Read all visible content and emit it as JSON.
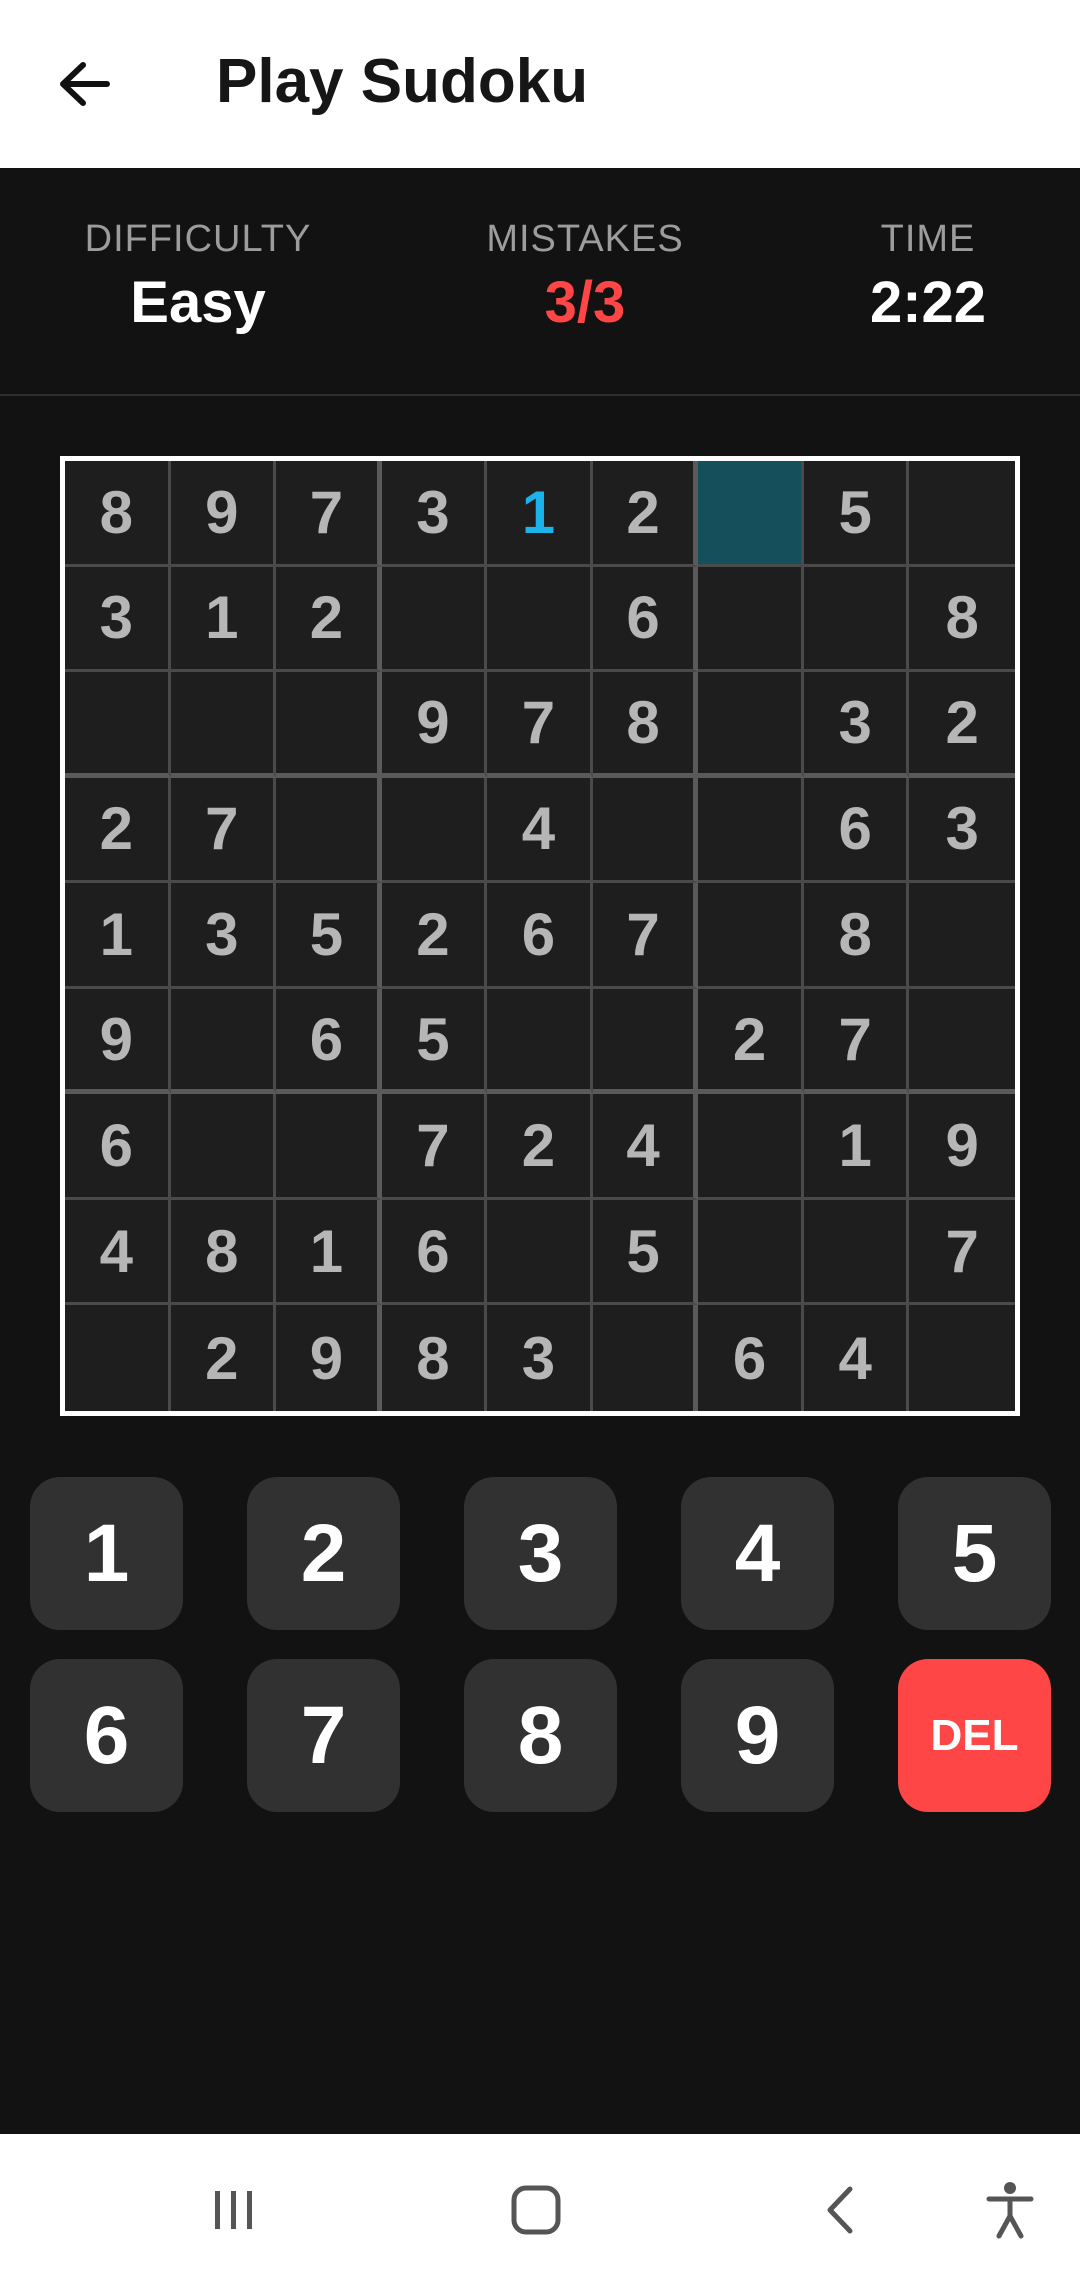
{
  "app_bar": {
    "title": "Play Sudoku",
    "back_icon": "arrow-left-icon"
  },
  "stats": {
    "difficulty_label": "DIFFICULTY",
    "difficulty_value": "Easy",
    "mistakes_label": "MISTAKES",
    "mistakes_value": "3/3",
    "time_label": "TIME",
    "time_value": "2:22"
  },
  "board": {
    "rows": [
      [
        "8",
        "9",
        "7",
        "3",
        "1",
        "2",
        "",
        "5",
        ""
      ],
      [
        "3",
        "1",
        "2",
        "",
        "",
        "6",
        "",
        "",
        "8"
      ],
      [
        "",
        "",
        "",
        "9",
        "7",
        "8",
        "",
        "3",
        "2"
      ],
      [
        "2",
        "7",
        "",
        "",
        "4",
        "",
        "",
        "6",
        "3"
      ],
      [
        "1",
        "3",
        "5",
        "2",
        "6",
        "7",
        "",
        "8",
        ""
      ],
      [
        "9",
        "",
        "6",
        "5",
        "",
        "",
        "2",
        "7",
        ""
      ],
      [
        "6",
        "",
        "",
        "7",
        "2",
        "4",
        "",
        "1",
        "9"
      ],
      [
        "4",
        "8",
        "1",
        "6",
        "",
        "5",
        "",
        "",
        "7"
      ],
      [
        "",
        "2",
        "9",
        "8",
        "3",
        "",
        "6",
        "4",
        ""
      ]
    ],
    "user_entered": [
      [
        0,
        4
      ]
    ],
    "selected": [
      0,
      6
    ]
  },
  "keypad": {
    "keys": [
      "1",
      "2",
      "3",
      "4",
      "5",
      "6",
      "7",
      "8",
      "9",
      "DEL"
    ]
  },
  "colors": {
    "accent_red": "#ff4646",
    "user_digit": "#1cb3ea",
    "selected_cell": "#164f5c",
    "background": "#121212"
  },
  "system_nav": {
    "recents_icon": "recents-icon",
    "home_icon": "home-icon",
    "back_icon": "back-chevron-icon",
    "accessibility_icon": "accessibility-icon"
  }
}
